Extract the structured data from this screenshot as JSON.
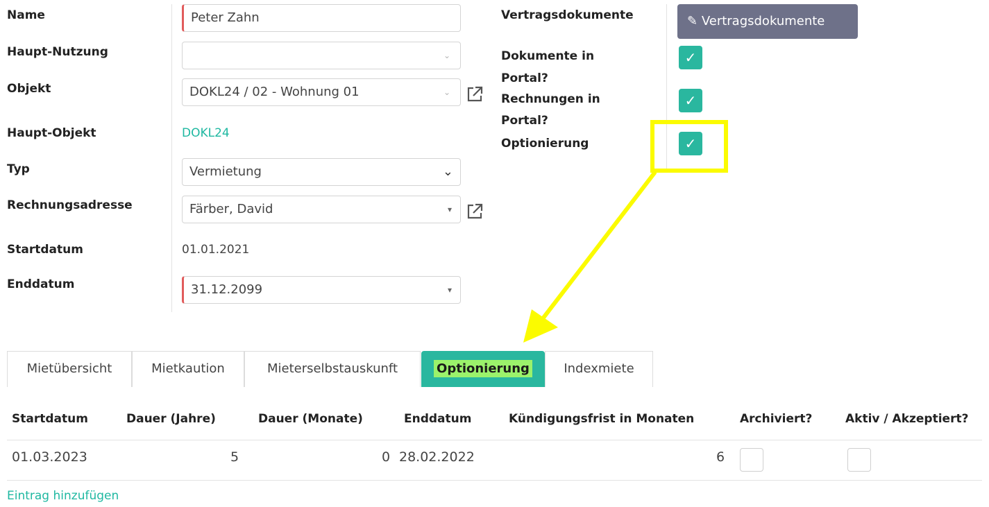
{
  "form_left": {
    "name_label": "Name",
    "name_value": "Peter Zahn",
    "haupt_nutzung_label": "Haupt-Nutzung",
    "haupt_nutzung_value": "",
    "objekt_label": "Objekt",
    "objekt_value": "DOKL24 / 02 - Wohnung 01",
    "haupt_objekt_label": "Haupt-Objekt",
    "haupt_objekt_value": "DOKL24",
    "typ_label": "Typ",
    "typ_value": "Vermietung",
    "rechnungsadresse_label": "Rechnungsadresse",
    "rechnungsadresse_value": "Färber, David",
    "startdatum_label": "Startdatum",
    "startdatum_value": "01.01.2021",
    "enddatum_label": "Enddatum",
    "enddatum_value": "31.12.2099"
  },
  "form_right": {
    "vertragsdokumente_label": "Vertragsdokumente",
    "vertragsdokumente_button": "Vertragsdokumente",
    "dokumente_portal_label_1": "Dokumente in",
    "dokumente_portal_label_2": "Portal?",
    "rechnungen_portal_label_1": "Rechnungen in",
    "rechnungen_portal_label_2": "Portal?",
    "optionierung_label": "Optionierung",
    "dokumente_portal_checked": true,
    "rechnungen_portal_checked": true,
    "optionierung_checked": true
  },
  "tabs": [
    {
      "label": "Mietübersicht",
      "active": false
    },
    {
      "label": "Mietkaution",
      "active": false
    },
    {
      "label": "Mieterselbstauskunft",
      "active": false
    },
    {
      "label": "Optionierung",
      "active": true
    },
    {
      "label": "Indexmiete",
      "active": false
    }
  ],
  "table": {
    "headers": [
      "Startdatum",
      "Dauer (Jahre)",
      "Dauer (Monate)",
      "Enddatum",
      "Kündigungsfrist in Monaten",
      "Archiviert?",
      "Aktiv / Akzeptiert?"
    ],
    "row": {
      "startdatum": "01.03.2023",
      "dauer_jahre": "5",
      "dauer_monate": "0",
      "enddatum": "28.02.2022",
      "kuendigungsfrist": "6",
      "archiviert": false,
      "aktiv": false
    },
    "add_entry": "Eintrag hinzufügen"
  },
  "colors": {
    "accent": "#2ab79f",
    "annotation": "#fbfb00",
    "required": "#e15b5b",
    "button_gray": "#6e7189"
  },
  "icons": {
    "checkmark": "✓",
    "paperclip": "✎",
    "external_link": "external-link-icon"
  }
}
